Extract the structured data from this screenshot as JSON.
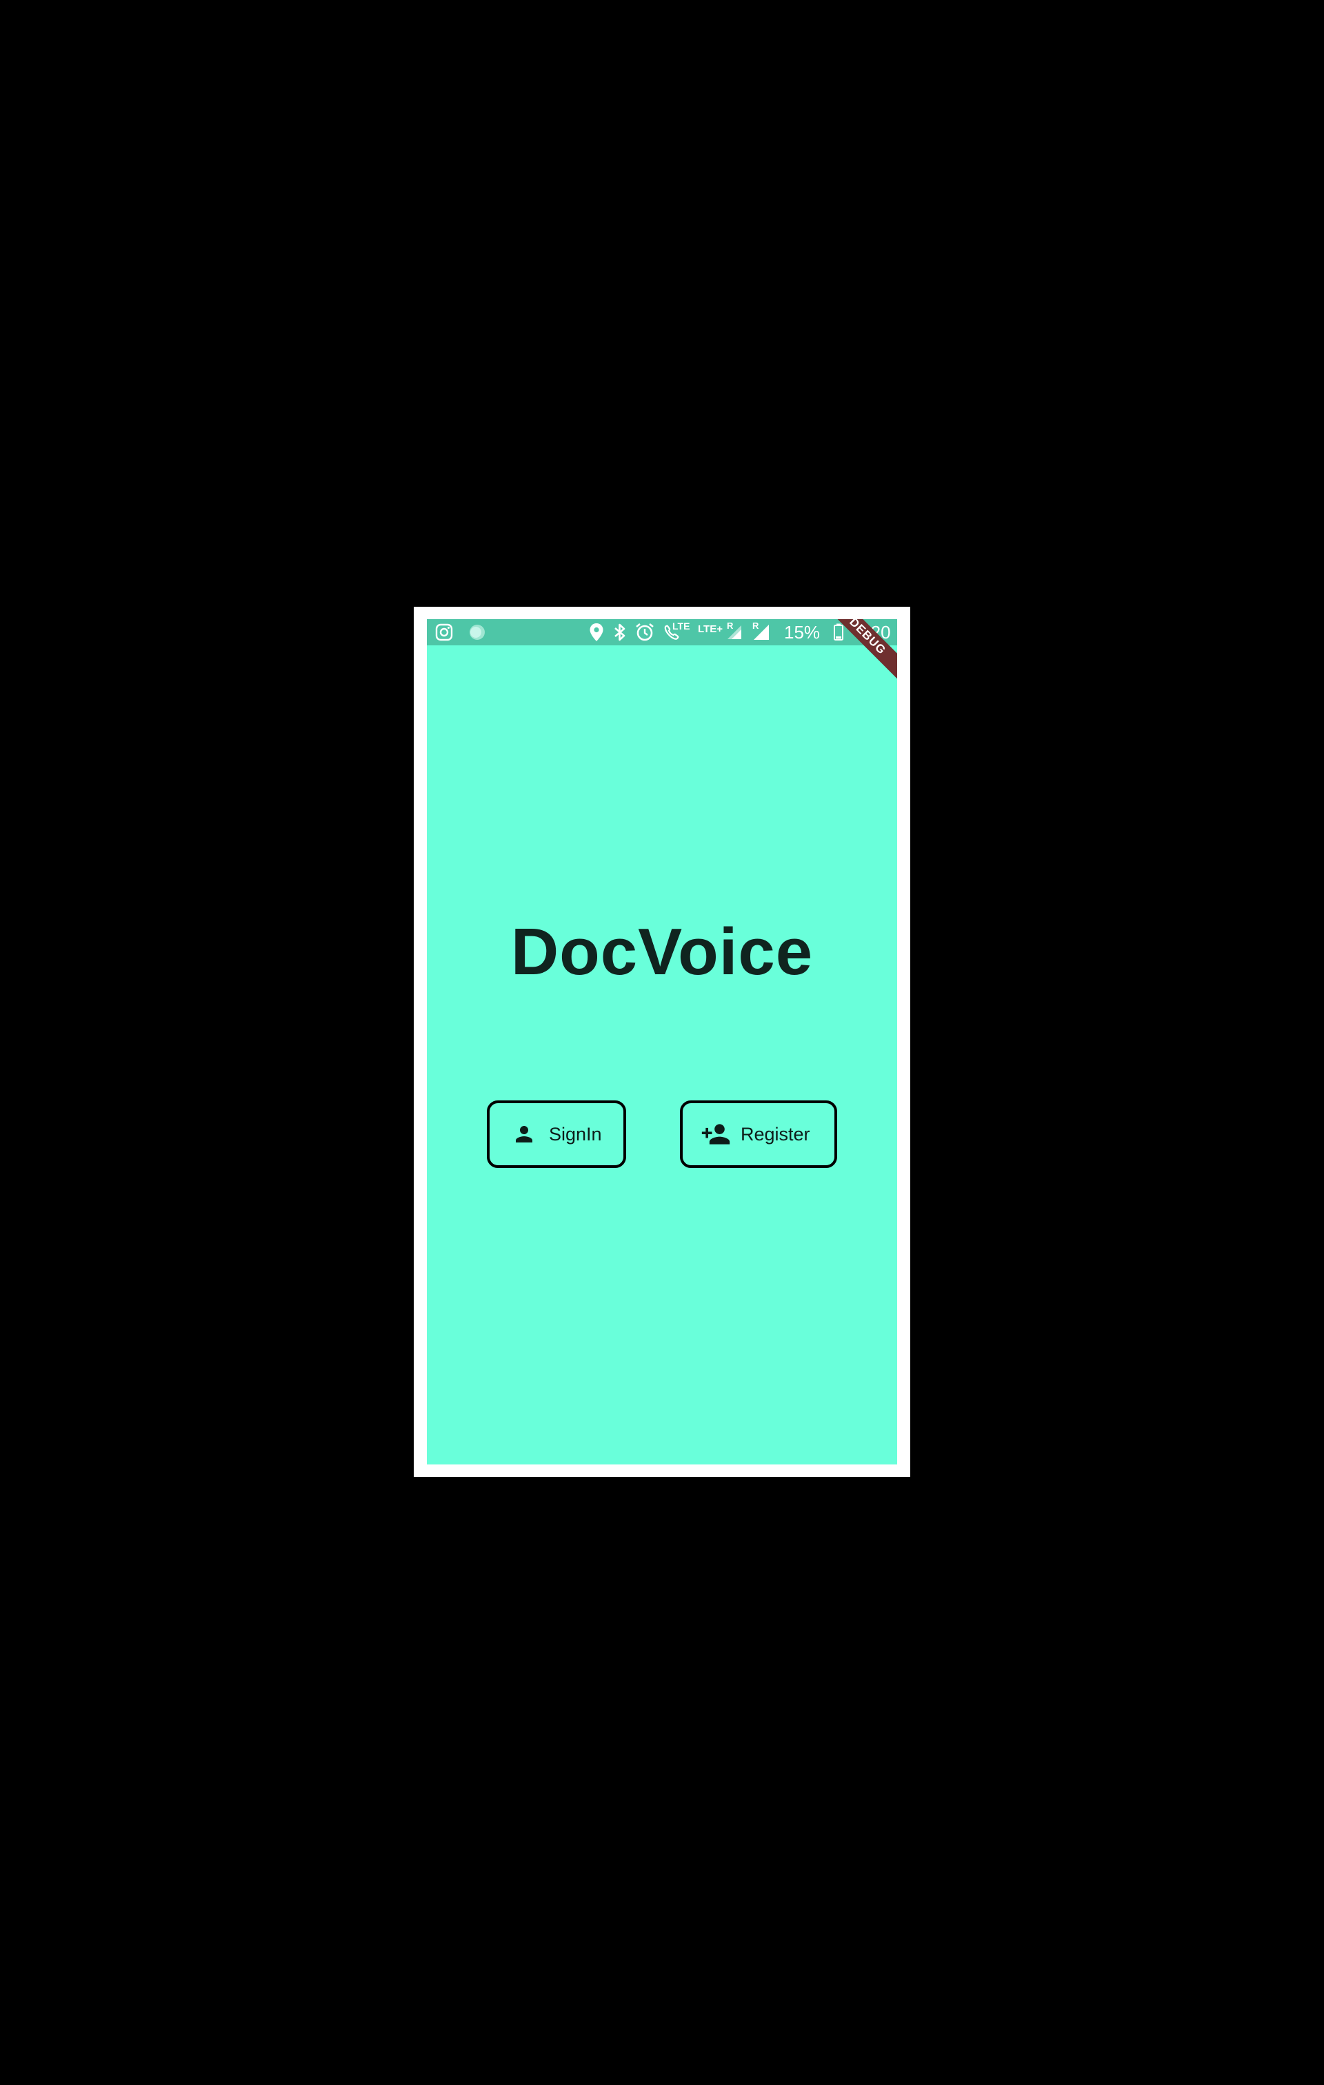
{
  "status_bar": {
    "icons": [
      "instagram-icon",
      "notification-dot-icon",
      "location-icon",
      "bluetooth-icon",
      "alarm-icon",
      "volte-call-icon",
      "lte-signal-icon",
      "signal-icon"
    ],
    "call_badge": "LTE",
    "network_label": "LTE+",
    "roaming_label_1": "R",
    "roaming_label_2": "R",
    "battery": "15%",
    "time": "9:20",
    "color": "#4ec6a7"
  },
  "debug_banner": "DEBUG",
  "app": {
    "title": "DocVoice",
    "background": "#69ffda"
  },
  "buttons": {
    "signin": {
      "label": "SignIn",
      "icon": "person-icon"
    },
    "register": {
      "label": "Register",
      "icon": "person-add-icon"
    }
  }
}
